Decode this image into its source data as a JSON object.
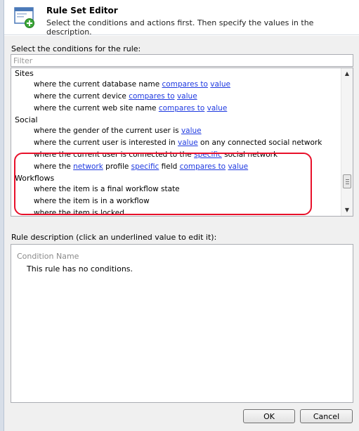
{
  "header": {
    "title": "Rule Set Editor",
    "subtitle": "Select the conditions and actions first. Then specify the values in the description."
  },
  "conditions": {
    "label": "Select the conditions for the rule:",
    "filter_placeholder": "Filter",
    "groups": [
      {
        "title": "Sites",
        "rows": [
          [
            {
              "t": "where the current database name "
            },
            {
              "t": "compares to",
              "link": true
            },
            {
              "t": " "
            },
            {
              "t": "value",
              "link": true
            }
          ],
          [
            {
              "t": "where the current device "
            },
            {
              "t": "compares to",
              "link": true
            },
            {
              "t": " "
            },
            {
              "t": "value",
              "link": true
            }
          ],
          [
            {
              "t": "where the current web site name "
            },
            {
              "t": "compares to",
              "link": true
            },
            {
              "t": " "
            },
            {
              "t": "value",
              "link": true
            }
          ]
        ]
      },
      {
        "title": "Social",
        "rows": [
          [
            {
              "t": "where the gender of the current user is "
            },
            {
              "t": "value",
              "link": true
            }
          ],
          [
            {
              "t": "where the current user is interested in "
            },
            {
              "t": "value",
              "link": true
            },
            {
              "t": " on any connected social network"
            }
          ],
          [
            {
              "t": "where the current user is connected to the "
            },
            {
              "t": "specific",
              "link": true
            },
            {
              "t": " social network"
            }
          ],
          [
            {
              "t": "where the "
            },
            {
              "t": "network",
              "link": true
            },
            {
              "t": " profile "
            },
            {
              "t": "specific",
              "link": true
            },
            {
              "t": " field "
            },
            {
              "t": "compares to",
              "link": true
            },
            {
              "t": " "
            },
            {
              "t": "value",
              "link": true
            }
          ]
        ]
      },
      {
        "title": "Workflows",
        "rows": [
          [
            {
              "t": "where the item is a final workflow state"
            }
          ],
          [
            {
              "t": "where the item is in a workflow"
            }
          ],
          [
            {
              "t": "where the item is locked"
            }
          ]
        ]
      }
    ]
  },
  "description": {
    "label": "Rule description (click an underlined value to edit it):",
    "condition_name": "Condition Name",
    "empty_text": "This rule has no conditions."
  },
  "buttons": {
    "ok": "OK",
    "cancel": "Cancel"
  },
  "colors": {
    "link": "#1f3ae0",
    "highlight": "#e8102a"
  }
}
